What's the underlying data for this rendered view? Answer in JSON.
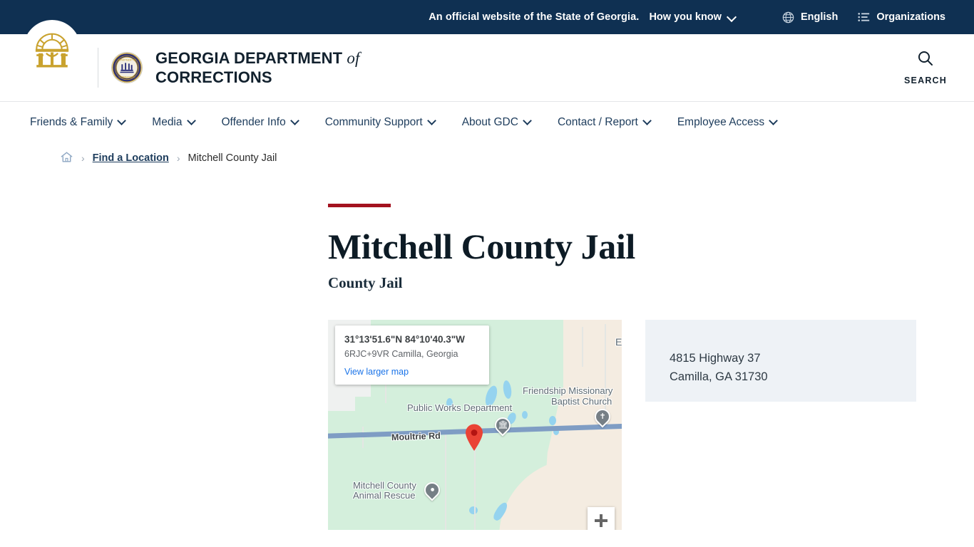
{
  "gov_banner": {
    "official_text": "An official website of the State of Georgia.",
    "how_you_know": "How you know",
    "language": "English",
    "organizations": "Organizations",
    "background_color": "#0f3052"
  },
  "header": {
    "brand_line1": "GEORGIA DEPARTMENT",
    "brand_of": "of",
    "brand_line2": "CORRECTIONS",
    "search_label": "SEARCH"
  },
  "nav": {
    "items": [
      {
        "label": "Friends & Family",
        "has_dropdown": true
      },
      {
        "label": "Media",
        "has_dropdown": true
      },
      {
        "label": "Offender Info",
        "has_dropdown": true
      },
      {
        "label": "Community Support",
        "has_dropdown": true
      },
      {
        "label": "About GDC",
        "has_dropdown": true
      },
      {
        "label": "Contact / Report",
        "has_dropdown": true
      },
      {
        "label": "Employee Access",
        "has_dropdown": true
      }
    ]
  },
  "breadcrumb": {
    "home_icon": "home-icon",
    "separator": "›",
    "items": [
      {
        "label": "Find a Location",
        "link": true
      },
      {
        "label": "Mitchell County Jail",
        "link": false
      }
    ]
  },
  "page": {
    "accent_color": "#a3121f",
    "title": "Mitchell County Jail",
    "subtitle": "County Jail"
  },
  "map": {
    "card": {
      "coordinates": "31°13'51.6\"N 84°10'40.3\"W",
      "plus_code": "6RJC+9VR Camilla, Georgia",
      "view_larger": "View larger map"
    },
    "labels": [
      {
        "text": "Public Works Department",
        "type": "poi"
      },
      {
        "text": "Friendship Missionary",
        "type": "poi"
      },
      {
        "text": "Baptist Church",
        "type": "poi"
      },
      {
        "text": "Mitchell County",
        "type": "poi"
      },
      {
        "text": "Animal Rescue",
        "type": "poi"
      },
      {
        "text": "Moultrie Rd",
        "type": "road"
      },
      {
        "text": "E",
        "type": "road-clipped"
      }
    ],
    "zoom_in_label": "+",
    "marker_color": "#ea4335"
  },
  "address": {
    "street": "4815 Highway 37",
    "city_state_zip": "Camilla, GA 31730"
  }
}
